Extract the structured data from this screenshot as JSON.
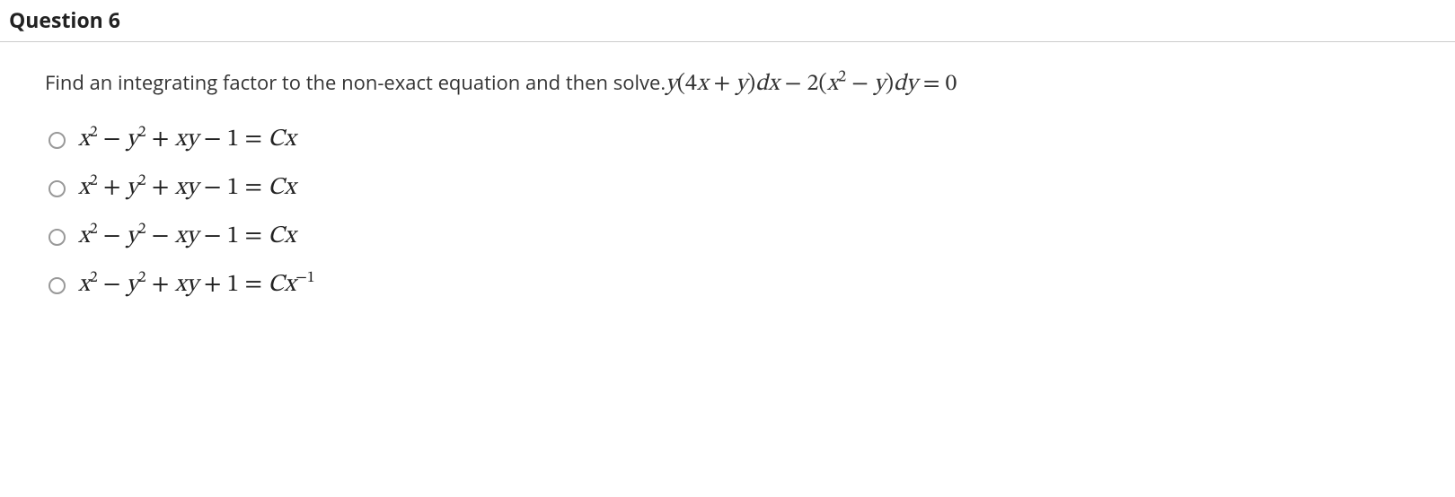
{
  "question": {
    "number_label": "Question 6",
    "prompt_text": "Find an integrating factor to the non-exact equation and then solve.",
    "equation_html": "<span class='rm'> </span>y<span class='rm'>(4</span>x<span class='rm'> + </span>y<span class='rm'>)</span>dx<span class='rm'> − 2(</span>x<sup>2</sup><span class='rm'> − </span>y<span class='rm'>)</span>dy<span class='rm'> = 0</span>"
  },
  "options": [
    {
      "html": "x<sup><span class='rm'>2</span></sup><span class='rm'> − </span>y<sup><span class='rm'>2</span></sup><span class='rm'> + </span>xy<span class='rm'> − 1 = </span>Cx"
    },
    {
      "html": "x<sup><span class='rm'>2</span></sup><span class='rm'> + </span>y<sup><span class='rm'>2</span></sup><span class='rm'> + </span>xy<span class='rm'> − 1 = </span>Cx"
    },
    {
      "html": "x<sup><span class='rm'>2</span></sup><span class='rm'> − </span>y<sup><span class='rm'>2</span></sup><span class='rm'> − </span>xy<span class='rm'> − 1 = </span>Cx"
    },
    {
      "html": "x<sup><span class='rm'>2</span></sup><span class='rm'> − </span>y<sup><span class='rm'>2</span></sup><span class='rm'> + </span>xy<span class='rm'> + 1 = </span>Cx<sup><span class='rm'>−1</span></sup>"
    }
  ]
}
